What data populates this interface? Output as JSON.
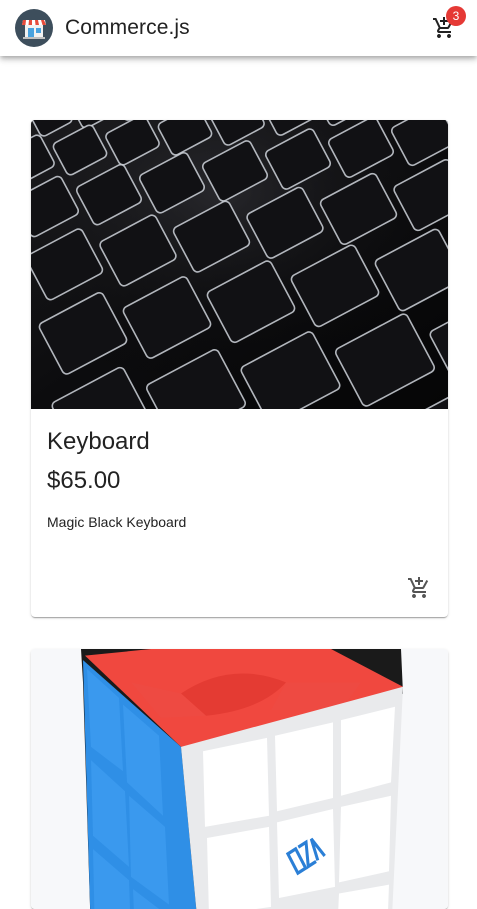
{
  "header": {
    "brand": "Commerce.js",
    "logo_icon": "shop-storefront-icon",
    "cart_icon": "shopping-cart-icon",
    "cart_count": "3"
  },
  "products": [
    {
      "name": "Keyboard",
      "price": "$65.00",
      "description": "Magic Black Keyboard",
      "image": "keyboard-photo",
      "action_icon": "add-shopping-cart-icon"
    },
    {
      "image": "rubiks-cube-photo"
    }
  ],
  "colors": {
    "badge": "#e53935",
    "text": "#222222",
    "icon": "#555555"
  }
}
